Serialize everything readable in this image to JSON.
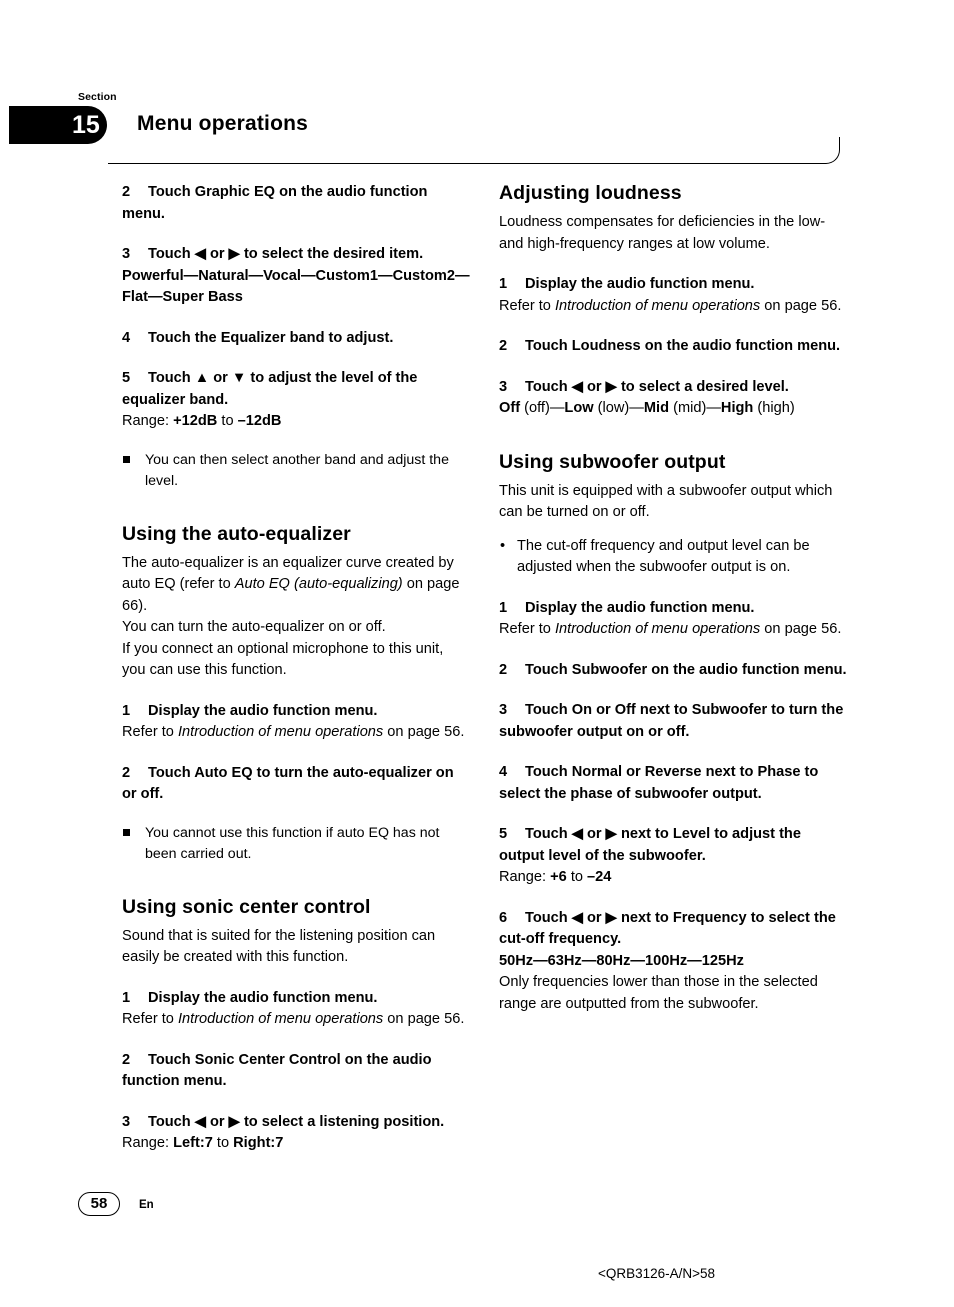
{
  "header": {
    "section_label": "Section",
    "section_number": "15",
    "chapter_title": "Menu operations"
  },
  "footer": {
    "page_number": "58",
    "language": "En",
    "doc_code": "<QRB3126-A/N>58"
  },
  "left_column": {
    "steps_continued": [
      {
        "num": "2",
        "text": "Touch Graphic EQ on the audio function menu."
      },
      {
        "num": "3",
        "text": "Touch ◀ or ▶ to select the desired item.",
        "detail": "Powerful—Natural—Vocal—Custom1—Custom2—Flat—Super Bass"
      },
      {
        "num": "4",
        "text": "Touch the Equalizer band to adjust."
      },
      {
        "num": "5",
        "text": "Touch ▲ or ▼ to adjust the level of the equalizer band.",
        "range_label": "Range: ",
        "range_from": "+12dB",
        "range_mid": " to ",
        "range_to": "–12dB",
        "note": "You can then select another band and adjust the level."
      }
    ],
    "sections": [
      {
        "title": "Using the auto-equalizer",
        "intro_1": "The auto-equalizer is an equalizer curve created by auto EQ (refer to ",
        "intro_1_italic": "Auto EQ (auto-equalizing)",
        "intro_1_end": " on page 66).",
        "intro_2": "You can turn the auto-equalizer on or off.",
        "intro_3": "If you connect an optional microphone to this unit, you can use this function.",
        "steps": [
          {
            "num": "1",
            "text": "Display the audio function menu.",
            "refer_pre": "Refer to ",
            "refer_italic": "Introduction of menu operations",
            "refer_post": " on page 56."
          },
          {
            "num": "2",
            "text": "Touch Auto EQ to turn the auto-equalizer on or off.",
            "note": "You cannot use this function if auto EQ has not been carried out."
          }
        ]
      },
      {
        "title": "Using sonic center control",
        "intro_1": "Sound that is suited for the listening position can easily be created with this function.",
        "steps": [
          {
            "num": "1",
            "text": "Display the audio function menu.",
            "refer_pre": "Refer to ",
            "refer_italic": "Introduction of menu operations",
            "refer_post": " on page 56."
          },
          {
            "num": "2",
            "text": "Touch Sonic Center Control on the audio function menu."
          },
          {
            "num": "3",
            "text": "Touch ◀ or ▶ to select a listening position.",
            "range_label": "Range: ",
            "range_from": "Left:7",
            "range_mid": " to ",
            "range_to": "Right:7"
          }
        ]
      }
    ]
  },
  "right_column": {
    "sections": [
      {
        "title": "Adjusting loudness",
        "intro_1": "Loudness compensates for deficiencies in the low- and high-frequency ranges at low volume.",
        "steps": [
          {
            "num": "1",
            "text": "Display the audio function menu.",
            "refer_pre": "Refer to ",
            "refer_italic": "Introduction of menu operations",
            "refer_post": " on page 56."
          },
          {
            "num": "2",
            "text": "Touch Loudness on the audio function menu."
          },
          {
            "num": "3",
            "text": "Touch ◀ or ▶ to select a desired level.",
            "options": [
              {
                "bold": "Off",
                "plain": " (off)"
              },
              {
                "sep": "—",
                "bold": "Low",
                "plain": " (low)"
              },
              {
                "sep": "—",
                "bold": "Mid",
                "plain": " (mid)"
              },
              {
                "sep": "—",
                "bold": "High",
                "plain": " (high)"
              }
            ]
          }
        ]
      },
      {
        "title": "Using subwoofer output",
        "intro_1": "This unit is equipped with a subwoofer output which can be turned on or off.",
        "bullet_1": "The cut-off frequency and output level can be adjusted when the subwoofer output is on.",
        "steps": [
          {
            "num": "1",
            "text": "Display the audio function menu.",
            "refer_pre": "Refer to ",
            "refer_italic": "Introduction of menu operations",
            "refer_post": " on page 56."
          },
          {
            "num": "2",
            "text": "Touch Subwoofer on the audio function menu."
          },
          {
            "num": "3",
            "text": "Touch On or Off next to Subwoofer to turn the subwoofer output on or off."
          },
          {
            "num": "4",
            "text": "Touch Normal or Reverse next to Phase to select the phase of subwoofer output."
          },
          {
            "num": "5",
            "text": "Touch ◀ or ▶ next to Level to adjust the output level of the subwoofer.",
            "range_label": "Range: ",
            "range_from": "+6",
            "range_mid": " to ",
            "range_to": "–24"
          },
          {
            "num": "6",
            "text": "Touch ◀ or ▶ next to Frequency to select the cut-off frequency.",
            "detail": "50Hz—63Hz—80Hz—100Hz—125Hz",
            "after": "Only frequencies lower than those in the selected range are outputted from the subwoofer."
          }
        ]
      }
    ]
  }
}
